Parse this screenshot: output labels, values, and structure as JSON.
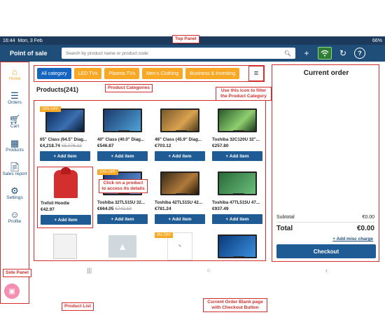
{
  "statusbar": {
    "time": "16:44",
    "date": "Mon, 3 Feb",
    "battery": "66%"
  },
  "topbar": {
    "title": "Point of sale",
    "search_placeholder": "Search by product name or product code",
    "add_icon": "plus-icon",
    "wifi_icon": "wifi-icon",
    "sync_icon": "sync-icon",
    "help_label": "?"
  },
  "sidebar": {
    "items": [
      {
        "label": "Home",
        "icon": "home-icon"
      },
      {
        "label": "Orders",
        "icon": "list-icon"
      },
      {
        "label": "Cart",
        "icon": "cart-icon"
      },
      {
        "label": "Products",
        "icon": "grid-icon"
      },
      {
        "label": "Sales report",
        "icon": "report-icon"
      },
      {
        "label": "Settings",
        "icon": "gear-icon"
      },
      {
        "label": "Profile",
        "icon": "person-icon"
      }
    ]
  },
  "categories": [
    {
      "label": "All category"
    },
    {
      "label": "LED TVs"
    },
    {
      "label": "Plasma TVs"
    },
    {
      "label": "Men's Clothing"
    },
    {
      "label": "Business & Investing"
    }
  ],
  "products": {
    "heading": "Products(241)",
    "add_label": "+ Add item",
    "items": [
      {
        "name": "65\" Class (64.5\" Diag...",
        "price": "€4,218.74",
        "old": "€5,076.12",
        "badge": "16% OFF"
      },
      {
        "name": "40\" Class (40.0\" Diag...",
        "price": "€546.87",
        "old": "",
        "badge": ""
      },
      {
        "name": "46\" Class (45.9\" Diag...",
        "price": "€703.12",
        "old": "",
        "badge": ""
      },
      {
        "name": "Toshiba 32C120U 32\"...",
        "price": "€257.80",
        "old": "",
        "badge": ""
      },
      {
        "name": "Trefoil Hoodie",
        "price": "€42.97",
        "old": "",
        "badge": ""
      },
      {
        "name": "Toshiba 32TL515U 32...",
        "price": "€664.05",
        "old": "€742.10",
        "badge": "10% OFF"
      },
      {
        "name": "Toshiba 42TL515U 42...",
        "price": "€781.24",
        "old": "",
        "badge": ""
      },
      {
        "name": "Toshiba 47TL515U 47...",
        "price": "€937.49",
        "old": "",
        "badge": ""
      },
      {
        "name": "",
        "price": "",
        "old": "",
        "badge": ""
      },
      {
        "name": "",
        "price": "",
        "old": "",
        "badge": ""
      },
      {
        "name": "",
        "price": "",
        "old": "",
        "badge": "0% OFF"
      },
      {
        "name": "",
        "price": "",
        "old": "",
        "badge": ""
      }
    ]
  },
  "order": {
    "title": "Current order",
    "subtotal_label": "Subtotal",
    "subtotal_value": "€0.00",
    "total_label": "Total",
    "total_value": "€0.00",
    "misc_label": "+ Add misc charge",
    "checkout_label": "Checkout"
  },
  "annotations": {
    "top_panel": "Top Panel",
    "product_categories": "Product Categories",
    "filter_note": "Use this icon to filter the Product Category",
    "click_note": "Click on a product to access its details",
    "side_panel": "Side Panel",
    "product_list": "Product List",
    "order_note": "Current Order Blank page with Checkout Button"
  },
  "colors": {
    "brand": "#1f4e79",
    "accent": "#f9a825",
    "annotation": "#d32f2f"
  }
}
